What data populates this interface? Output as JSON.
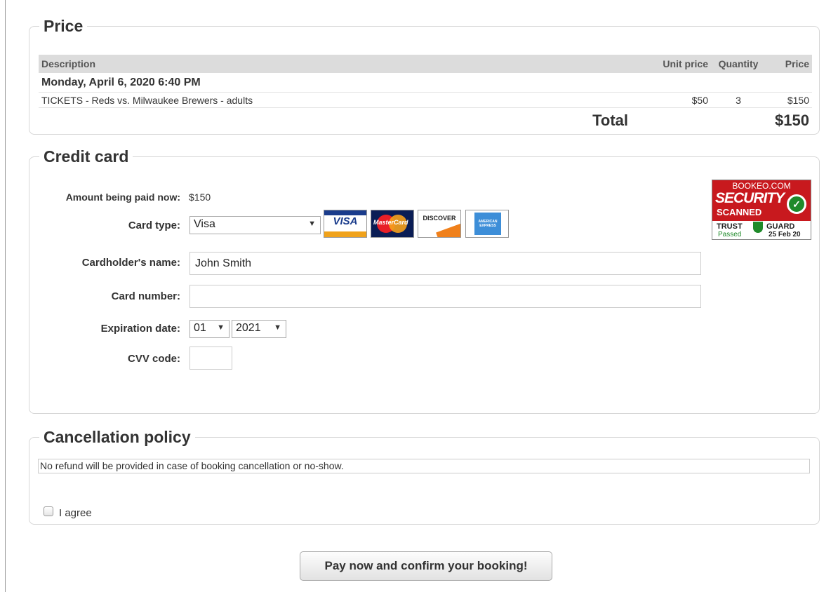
{
  "price": {
    "legend": "Price",
    "headers": {
      "description": "Description",
      "unit_price": "Unit price",
      "quantity": "Quantity",
      "price": "Price"
    },
    "date_row": "Monday, April 6, 2020 6:40 PM",
    "item": {
      "description": "TICKETS - Reds vs. Milwaukee Brewers - adults",
      "unit_price": "$50",
      "quantity": "3",
      "price": "$150"
    },
    "total_label": "Total",
    "total_value": "$150"
  },
  "credit_card": {
    "legend": "Credit card",
    "amount_label": "Amount being paid now:",
    "amount_value": "$150",
    "card_type_label": "Card type:",
    "card_type_value": "Visa",
    "card_logos": [
      "VISA",
      "MasterCard",
      "DISCOVER",
      "AMERICAN EXPRESS"
    ],
    "cardholder_label": "Cardholder's name:",
    "cardholder_value": "John Smith",
    "card_number_label": "Card number:",
    "card_number_value": "",
    "expiration_label": "Expiration date:",
    "exp_month": "01",
    "exp_year": "2021",
    "cvv_label": "CVV code:",
    "cvv_value": "",
    "badge": {
      "site": "BOOKEO.COM",
      "security": "SECURITY",
      "scanned": "SCANNED",
      "trust": "TRUST",
      "guard": "GUARD",
      "passed": "Passed",
      "date": "25 Feb 20"
    }
  },
  "cancellation": {
    "legend": "Cancellation policy",
    "text": "No refund will be provided in case of booking cancellation or no-show.",
    "agree_label": "I agree"
  },
  "pay_button": "Pay now and confirm your booking!",
  "colors": {
    "badge_red": "#c8191e",
    "badge_green": "#1f8a2a",
    "header_gray": "#dcdcdc"
  }
}
